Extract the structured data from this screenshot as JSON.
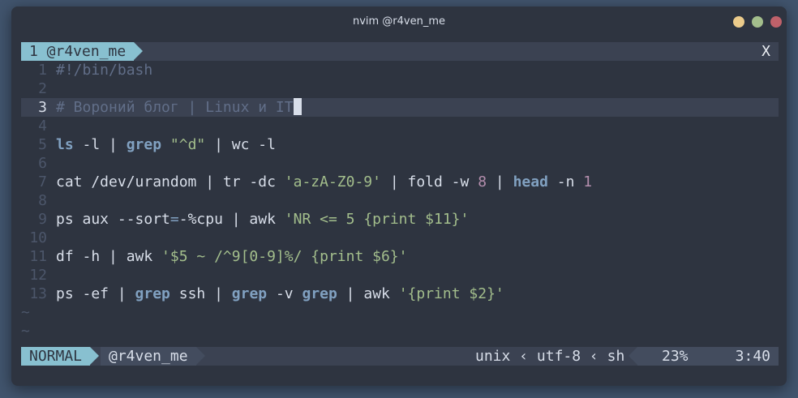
{
  "window": {
    "title": "nvim @r4ven_me"
  },
  "tabline": {
    "active_tab": "1 @r4ven_me",
    "close_label": "X"
  },
  "buffer": {
    "lines": [
      {
        "num": "1",
        "segments": [
          {
            "t": "#!/bin/bash",
            "c": "comment"
          }
        ]
      },
      {
        "num": "2",
        "segments": []
      },
      {
        "num": "3",
        "current": true,
        "segments": [
          {
            "t": "# Вороний блог | Linux и IT",
            "c": "comment"
          }
        ]
      },
      {
        "num": "4",
        "segments": []
      },
      {
        "num": "5",
        "segments": [
          {
            "t": "ls",
            "c": "kw"
          },
          {
            "t": " -l | ",
            "c": ""
          },
          {
            "t": "grep",
            "c": "kw"
          },
          {
            "t": " ",
            "c": ""
          },
          {
            "t": "\"^d\"",
            "c": "str"
          },
          {
            "t": " | wc -l",
            "c": ""
          }
        ]
      },
      {
        "num": "6",
        "segments": []
      },
      {
        "num": "7",
        "segments": [
          {
            "t": "cat /dev/urandom | tr -dc ",
            "c": ""
          },
          {
            "t": "'a-zA-Z0-9'",
            "c": "str"
          },
          {
            "t": " | fold -w ",
            "c": ""
          },
          {
            "t": "8",
            "c": "num"
          },
          {
            "t": " | ",
            "c": ""
          },
          {
            "t": "head",
            "c": "kw"
          },
          {
            "t": " -n ",
            "c": ""
          },
          {
            "t": "1",
            "c": "num"
          }
        ]
      },
      {
        "num": "8",
        "segments": []
      },
      {
        "num": "9",
        "segments": [
          {
            "t": "ps aux --sort",
            "c": ""
          },
          {
            "t": "=",
            "c": "op"
          },
          {
            "t": "-%cpu | awk ",
            "c": ""
          },
          {
            "t": "'NR <= 5 {print $11}'",
            "c": "str"
          }
        ]
      },
      {
        "num": "10",
        "segments": []
      },
      {
        "num": "11",
        "segments": [
          {
            "t": "df -h | awk ",
            "c": ""
          },
          {
            "t": "'$5 ~ /^9[0-9]%/ {print $6}'",
            "c": "str"
          }
        ]
      },
      {
        "num": "12",
        "segments": []
      },
      {
        "num": "13",
        "segments": [
          {
            "t": "ps -ef | ",
            "c": ""
          },
          {
            "t": "grep",
            "c": "kw"
          },
          {
            "t": " ssh | ",
            "c": ""
          },
          {
            "t": "grep",
            "c": "kw"
          },
          {
            "t": " -v ",
            "c": ""
          },
          {
            "t": "grep",
            "c": "kw"
          },
          {
            "t": " | awk ",
            "c": ""
          },
          {
            "t": "'{print $2}'",
            "c": "str"
          }
        ]
      }
    ],
    "empty_marker": "~"
  },
  "statusline": {
    "mode": "NORMAL",
    "branch": "@r4ven_me",
    "fileformat": "unix",
    "encoding": "utf-8",
    "filetype": "sh",
    "separator": "‹",
    "percent": "23%",
    "position": "3:40"
  }
}
